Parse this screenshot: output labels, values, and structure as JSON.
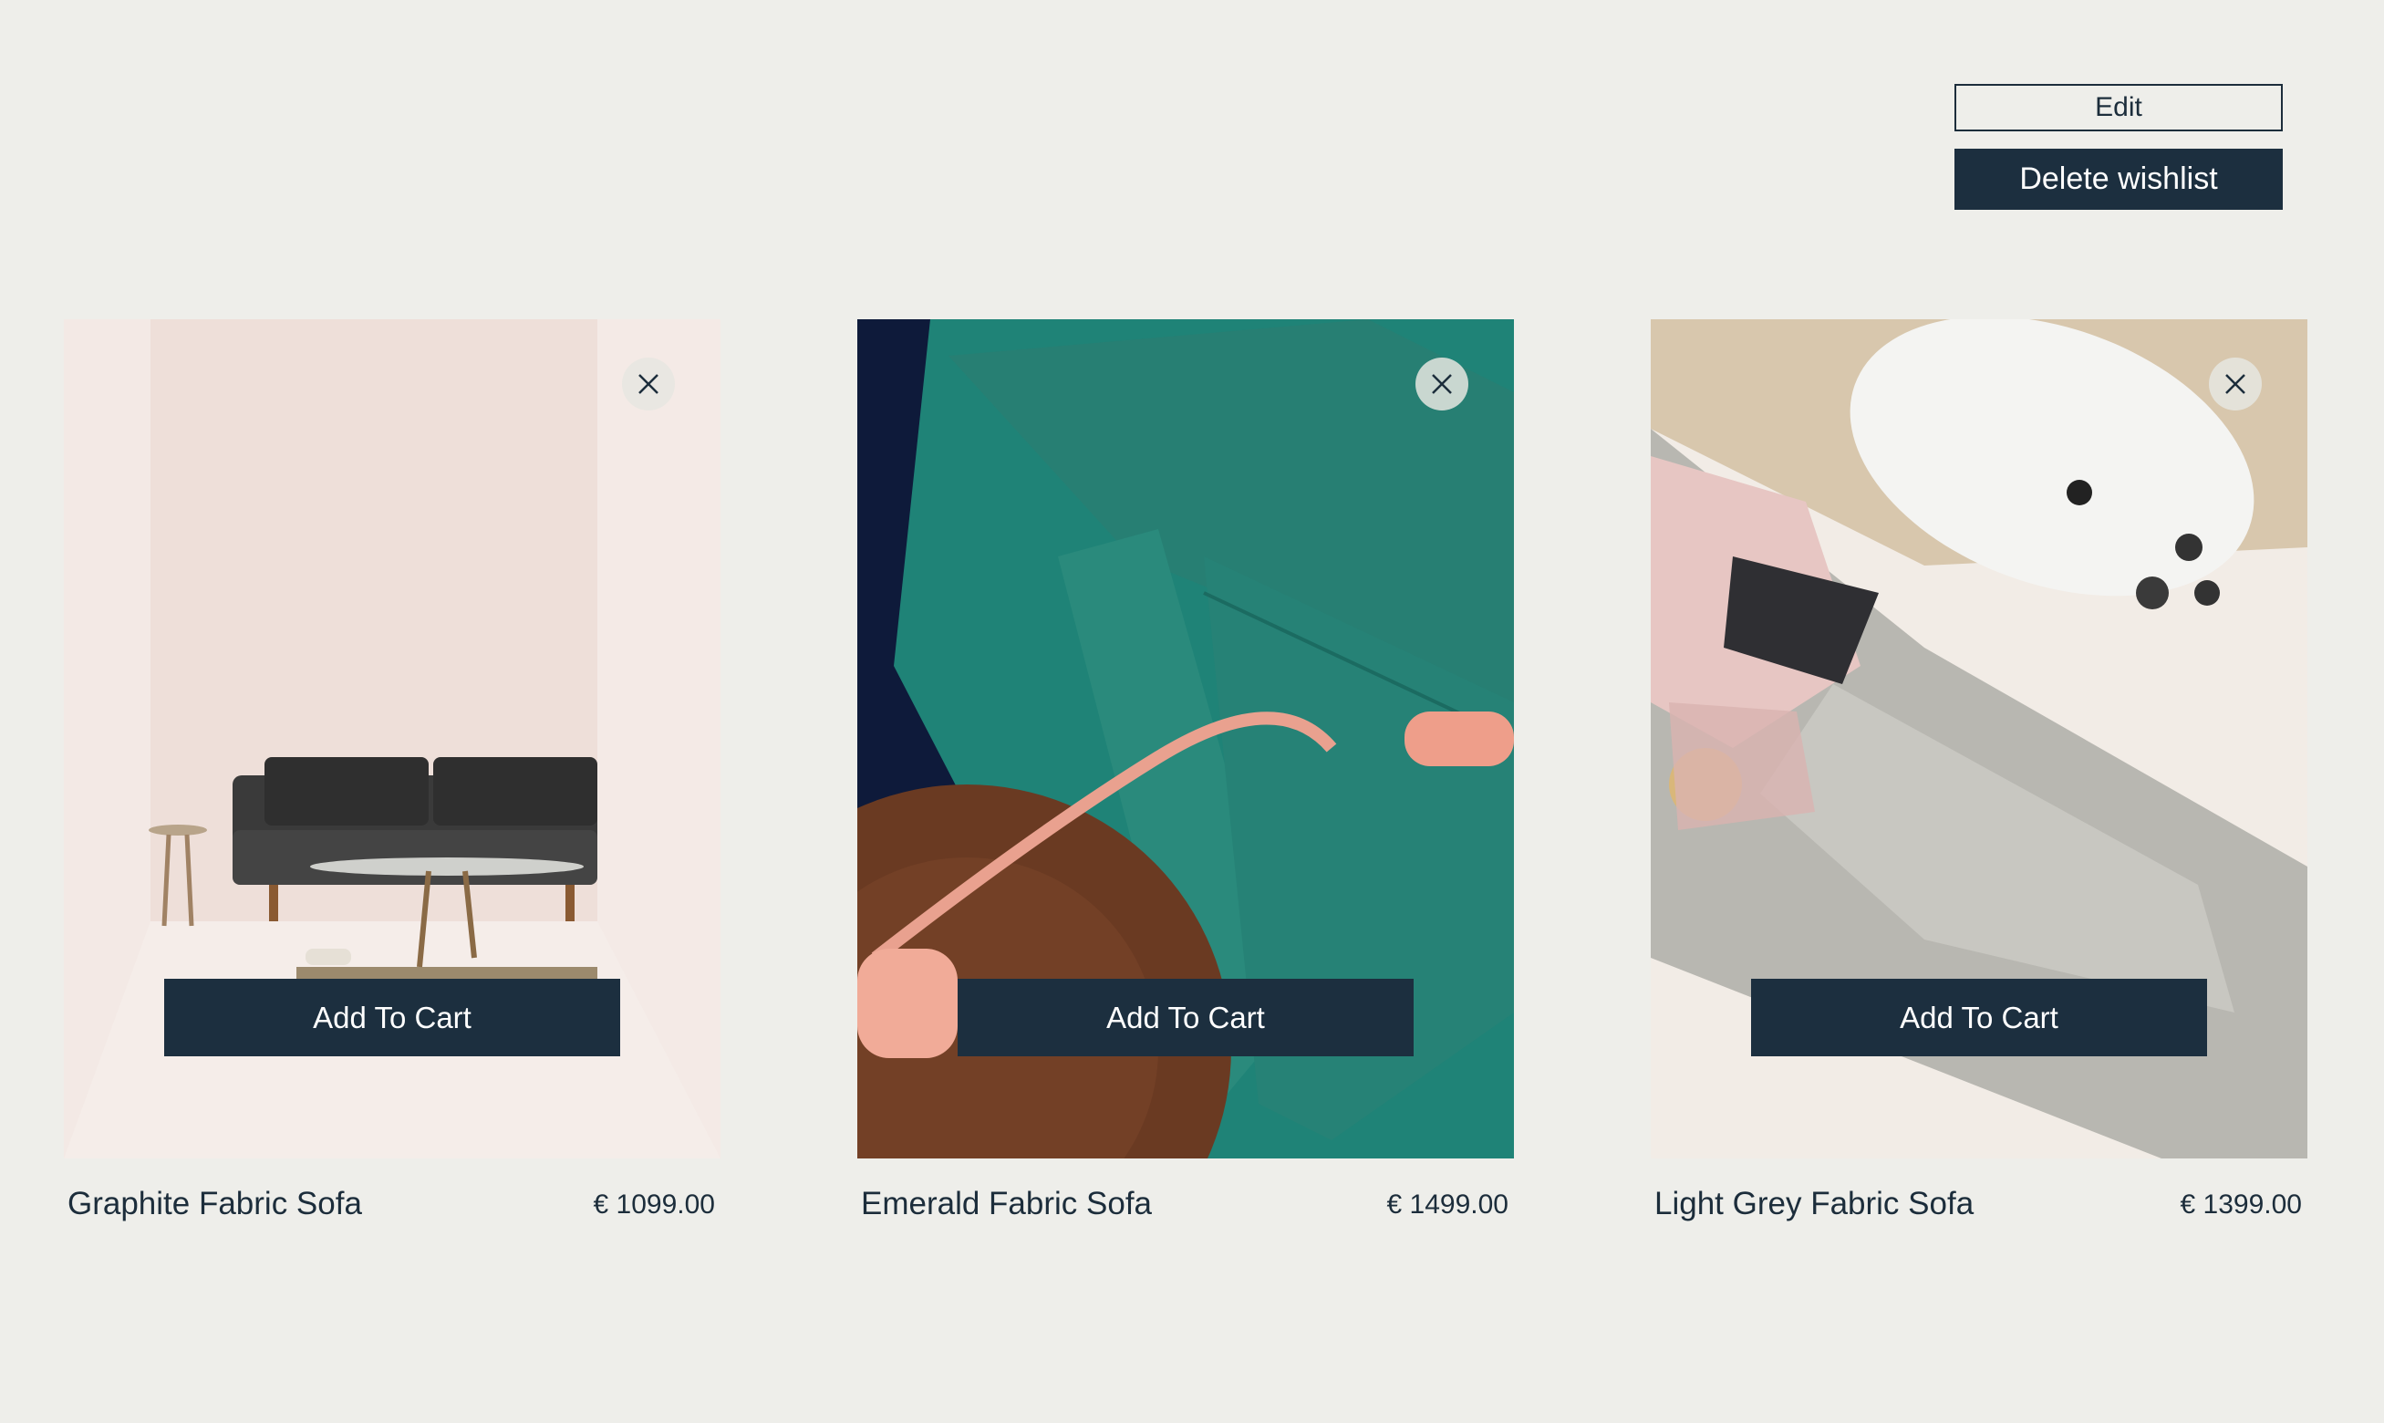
{
  "toolbar": {
    "edit_label": "Edit",
    "delete_label": "Delete wishlist"
  },
  "products": [
    {
      "name": "Graphite Fabric Sofa",
      "price": "€ 1099.00",
      "cta": "Add To Cart",
      "image": "graphite-sofa-photo"
    },
    {
      "name": "Emerald Fabric Sofa",
      "price": "€ 1499.00",
      "cta": "Add To Cart",
      "image": "emerald-sofa-photo"
    },
    {
      "name": "Light Grey Fabric Sofa",
      "price": "€ 1399.00",
      "cta": "Add To Cart",
      "image": "light-grey-sofa-photo"
    }
  ],
  "icons": {
    "remove": "close-icon"
  },
  "colors": {
    "background": "#eeeeea",
    "primary": "#1c2f3f",
    "text": "#1c2d3b"
  }
}
